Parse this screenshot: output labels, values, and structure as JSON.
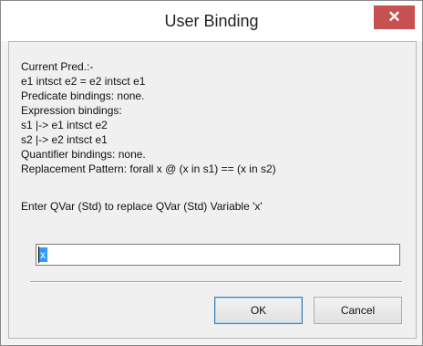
{
  "window": {
    "title": "User Binding",
    "close_glyph": "✕",
    "close_color": "#c75050"
  },
  "info_lines": [
    "Current Pred.:-",
    "e1 intsct e2 = e2 intsct e1",
    "Predicate bindings: none.",
    "Expression bindings:",
    "s1 |-> e1 intsct e2",
    "s2 |-> e2 intsct e1",
    "Quantifier bindings: none.",
    "Replacement Pattern: forall x @ (x in s1) == (x in s2)"
  ],
  "prompt": "Enter QVar (Std) to replace QVar (Std) Variable 'x'",
  "input": {
    "value": "x",
    "selection_color": "#3399ff"
  },
  "buttons": {
    "ok": "OK",
    "cancel": "Cancel"
  }
}
